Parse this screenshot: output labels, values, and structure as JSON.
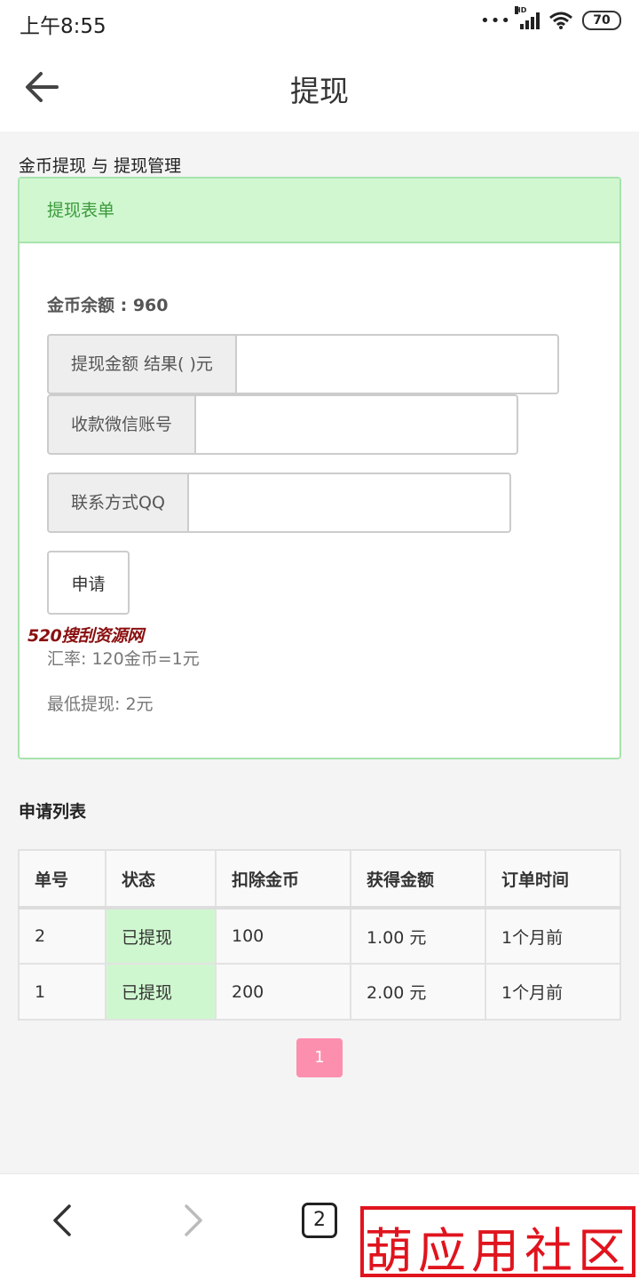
{
  "status_bar": {
    "time": "上午8:55",
    "battery": "70",
    "network_label": "HD"
  },
  "header": {
    "title": "提现"
  },
  "section_heading": "金币提现 与 提现管理",
  "form_panel": {
    "title": "提现表单",
    "balance_text": "金币余额 : 960",
    "fields": [
      {
        "label": "提现金额 结果( )元",
        "value": ""
      },
      {
        "label": "收款微信账号",
        "value": ""
      },
      {
        "label": "联系方式QQ",
        "value": ""
      }
    ],
    "apply_label": "申请",
    "watermark": "520搜刮资源网",
    "rate_text": "汇率: 120金币=1元",
    "min_text": "最低提现: 2元"
  },
  "list": {
    "title": "申请列表",
    "columns": [
      "单号",
      "状态",
      "扣除金币",
      "获得金额",
      "订单时间"
    ],
    "rows": [
      [
        "2",
        "已提现",
        "100",
        "1.00 元",
        "1个月前"
      ],
      [
        "1",
        "已提现",
        "200",
        "2.00 元",
        "1个月前"
      ]
    ]
  },
  "pagination": {
    "current": "1"
  },
  "bottom_nav": {
    "tab_count": "2",
    "stamp_text": "葫应用社区"
  },
  "colors": {
    "panel_border": "#a7e3ad",
    "panel_header_bg": "#d0f7d0",
    "panel_header_text": "#3c9a3c",
    "status_cell_bg": "#cff7cf",
    "pager_bg": "#fd8fae",
    "stamp": "#e0141e"
  }
}
